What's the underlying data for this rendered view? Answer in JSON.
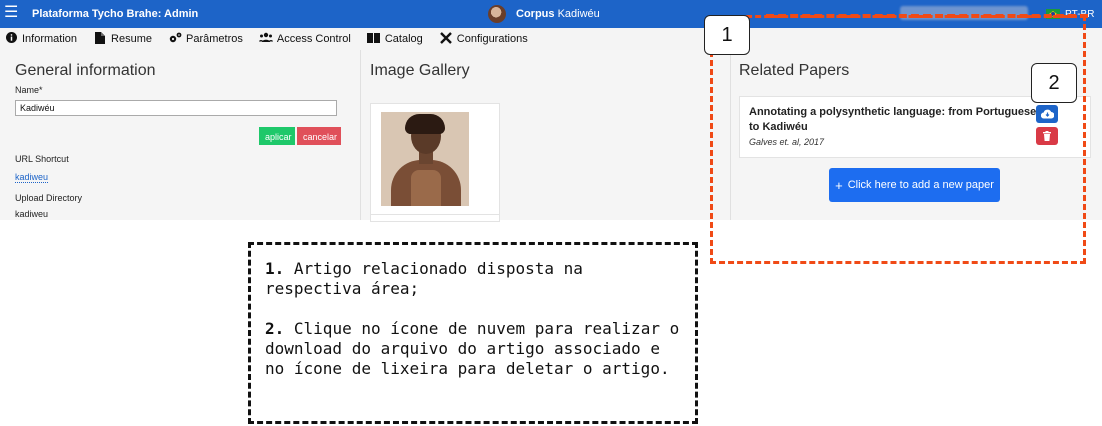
{
  "topbar": {
    "app_title": "Plataforma Tycho Brahe: Admin",
    "corpus_prefix": "Corpus",
    "corpus_name": "Kadiwéu",
    "language": "PT-BR",
    "menu_icon": "hamburger-icon"
  },
  "tabs": [
    {
      "label": "Information",
      "icon": "info-circle-icon"
    },
    {
      "label": "Resume",
      "icon": "file-icon"
    },
    {
      "label": "Parâmetros",
      "icon": "gears-icon"
    },
    {
      "label": "Access Control",
      "icon": "users-icon"
    },
    {
      "label": "Catalog",
      "icon": "book-icon"
    },
    {
      "label": "Configurations",
      "icon": "tools-icon"
    }
  ],
  "general": {
    "heading": "General information",
    "name_label": "Name*",
    "name_value": "Kadiwéu",
    "apply_label": "aplicar",
    "cancel_label": "cancelar",
    "url_shortcut_label": "URL Shortcut",
    "url_shortcut_value": "kadiweu",
    "upload_dir_label": "Upload Directory",
    "upload_dir_value": "kadiweu"
  },
  "gallery": {
    "heading": "Image Gallery"
  },
  "papers": {
    "heading": "Related Papers",
    "items": [
      {
        "title": "Annotating a polysynthetic language: from Portuguese to Kadiwéu",
        "authors": "Galves et. al, 2017"
      }
    ],
    "add_label": "Click here to add a new paper"
  },
  "annotations": {
    "badge_1": "1",
    "badge_2": "2",
    "note_1_num": "1.",
    "note_1_text": "Artigo relacionado disposta na respectiva área;",
    "note_2_num": "2.",
    "note_2_text": "Clique no ícone de nuvem para realizar o download do arquivo do artigo associado e no ícone de lixeira para deletar o artigo."
  },
  "colors": {
    "brand": "#1d64c8",
    "highlight": "#f04a16",
    "success": "#1ec86a",
    "danger": "#d93a46"
  }
}
